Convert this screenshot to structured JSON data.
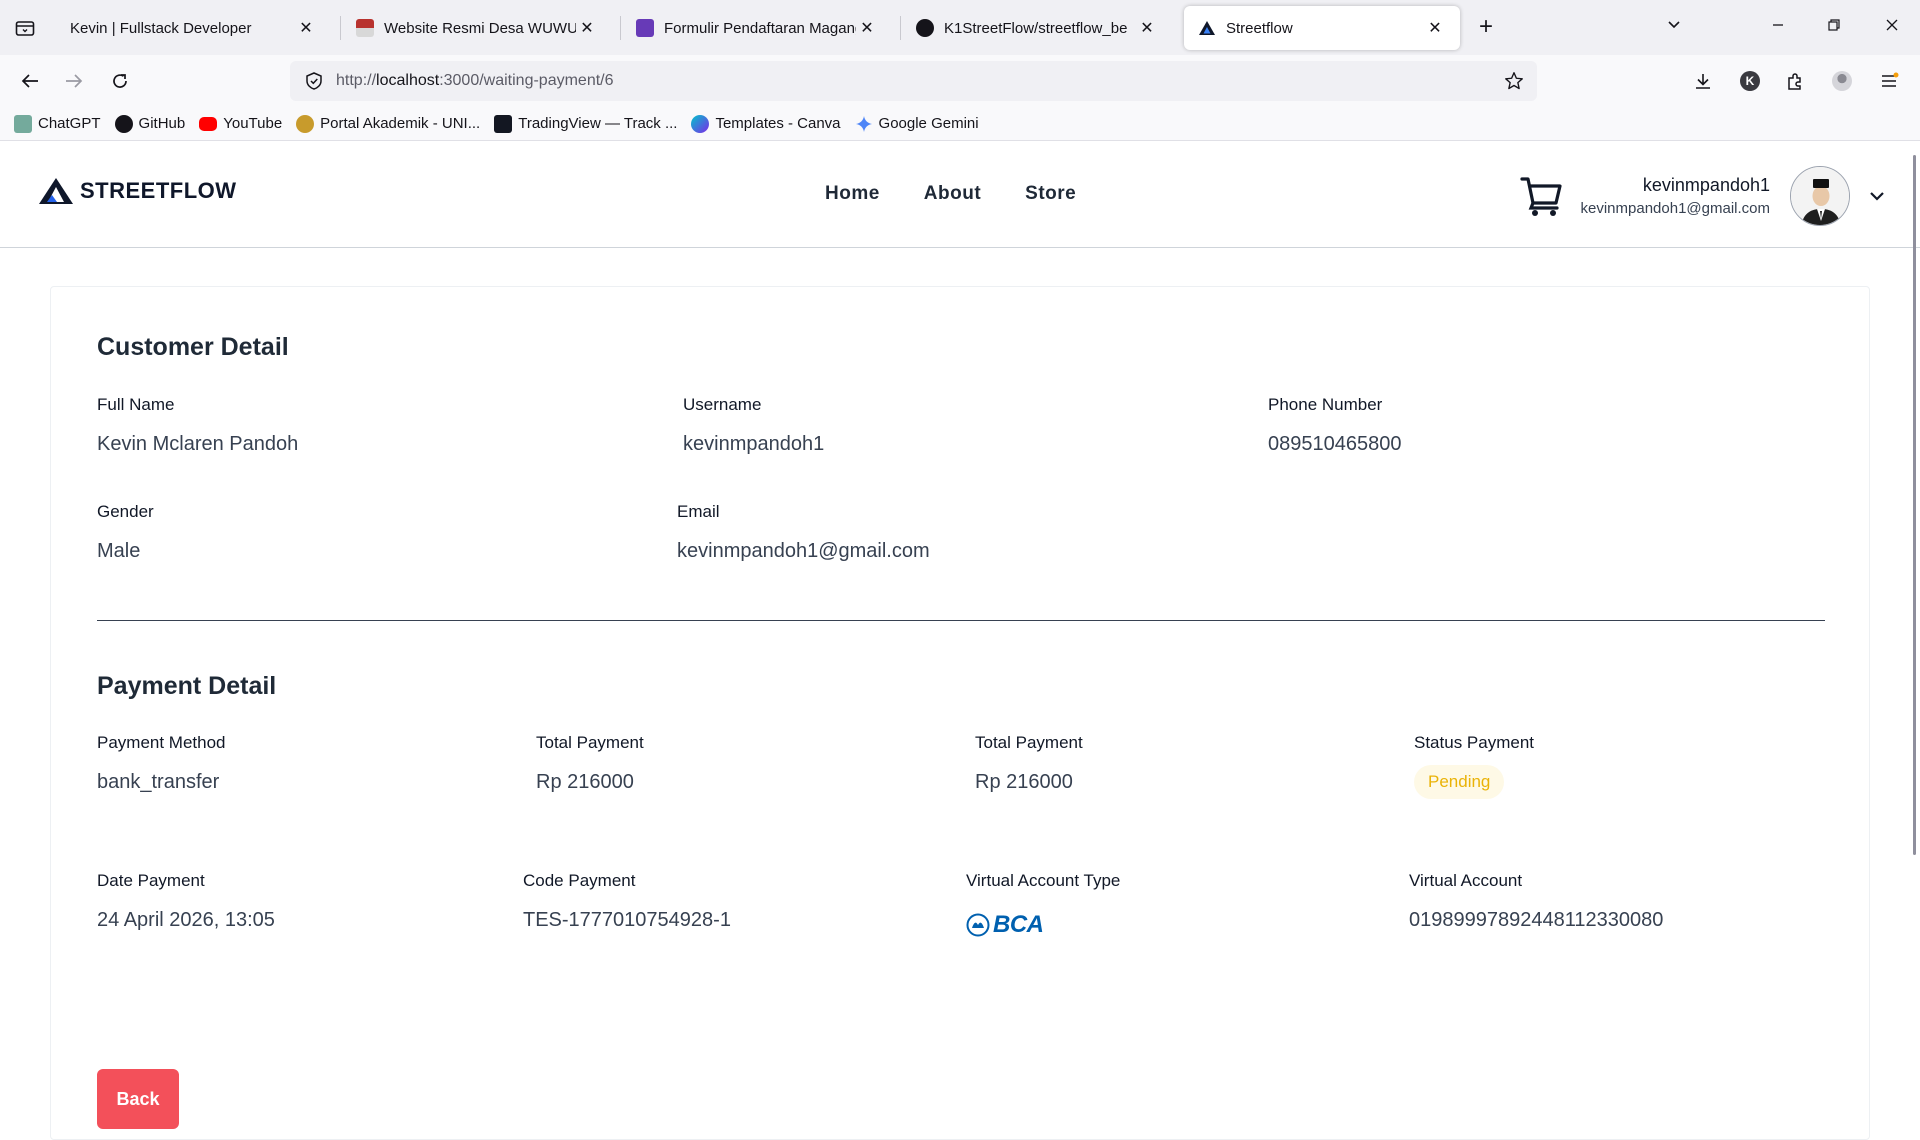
{
  "browser": {
    "tabs": [
      {
        "title": "Kevin | Fullstack Developer",
        "active": false
      },
      {
        "title": "Website Resmi Desa WUWUK",
        "active": false
      },
      {
        "title": "Formulir Pendaftaran Magang -",
        "active": false
      },
      {
        "title": "K1StreetFlow/streetflow_be",
        "active": false
      },
      {
        "title": "Streetflow",
        "active": true
      }
    ],
    "close_glyph": "✕",
    "new_tab_glyph": "+",
    "url_scheme": "http://",
    "url_host": "localhost",
    "url_path": ":3000/waiting-payment/6",
    "bookmarks": [
      "ChatGPT",
      "GitHub",
      "YouTube",
      "Portal Akademik - UNI...",
      "TradingView — Track ...",
      "Templates - Canva",
      "Google Gemini"
    ],
    "profile_initial": "K"
  },
  "site": {
    "brand": "STREETFLOW",
    "menu": [
      "Home",
      "About",
      "Store"
    ],
    "user_name": "kevinmpandoh1",
    "user_email": "kevinmpandoh1@gmail.com"
  },
  "customer": {
    "title": "Customer Detail",
    "full_name_label": "Full Name",
    "full_name": "Kevin Mclaren Pandoh",
    "username_label": "Username",
    "username": "kevinmpandoh1",
    "phone_label": "Phone Number",
    "phone": "089510465800",
    "gender_label": "Gender",
    "gender": "Male",
    "email_label": "Email",
    "email": "kevinmpandoh1@gmail.com"
  },
  "payment": {
    "title": "Payment Detail",
    "method_label": "Payment Method",
    "method": "bank_transfer",
    "total1_label": "Total Payment",
    "total1": "Rp 216000",
    "total2_label": "Total Payment",
    "total2": "Rp 216000",
    "status_label": "Status Payment",
    "status": "Pending",
    "date_label": "Date Payment",
    "date": "24 April 2026, 13:05",
    "code_label": "Code Payment",
    "code": "TES-1777010754928-1",
    "va_type_label": "Virtual Account Type",
    "va_type_logo_text": "BCA",
    "va_label": "Virtual Account",
    "va": "01989997892448112330080"
  },
  "actions": {
    "back": "Back"
  },
  "colors": {
    "accent": "#f3505a",
    "pending_text": "#eab308",
    "pending_bg": "#fef9e6",
    "bca_blue": "#0060af"
  }
}
